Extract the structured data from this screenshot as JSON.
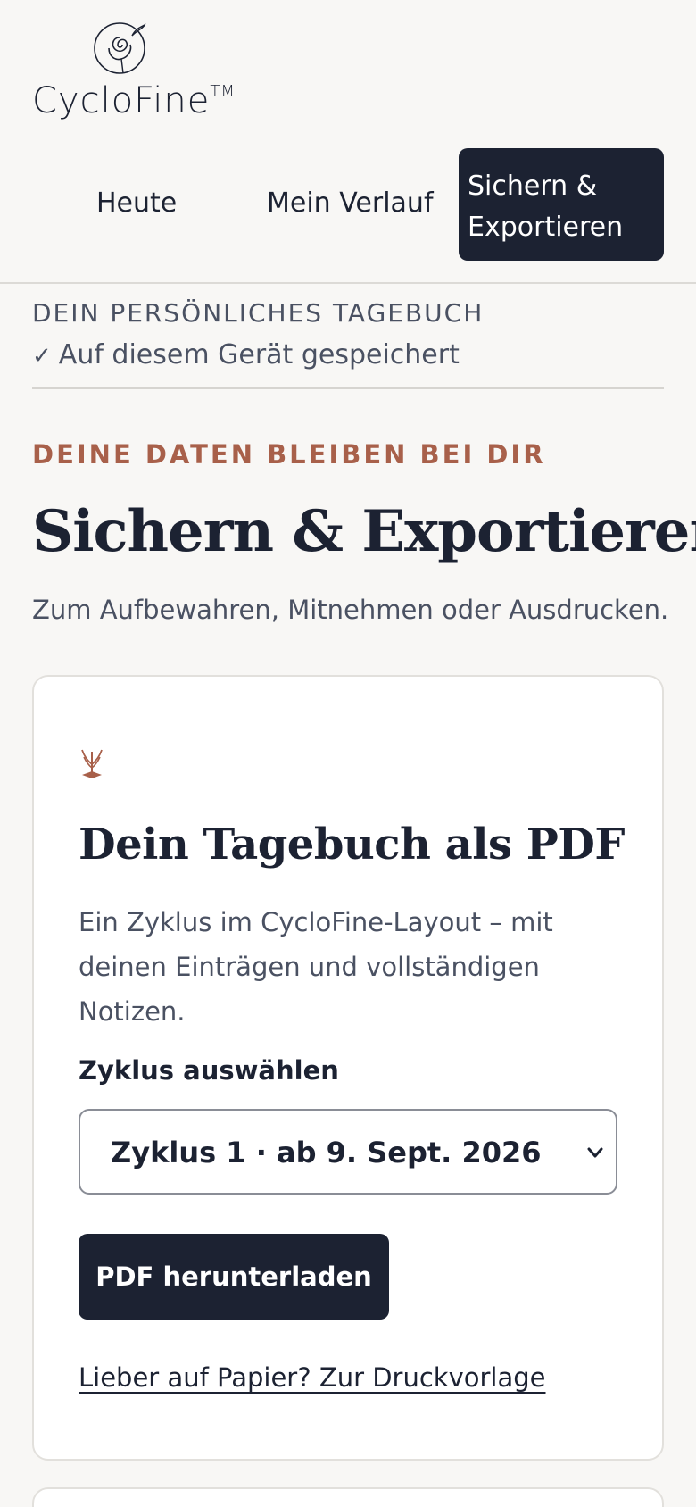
{
  "brand": {
    "name": "CycloFine",
    "trademark": "TM"
  },
  "nav": {
    "items": [
      {
        "label": "Heute"
      },
      {
        "label": "Mein Verlauf"
      },
      {
        "label": "Sichern & Exportieren",
        "active": true
      }
    ]
  },
  "diary": {
    "title": "DEIN PERSÖNLICHES TAGEBUCH",
    "status": "Auf diesem Gerät gespeichert"
  },
  "header": {
    "eyebrow": "DEINE DATEN BLEIBEN BEI DIR",
    "title": "Sichern & Exportieren",
    "subtitle": "Zum Aufbewahren, Mitnehmen oder Ausdrucken."
  },
  "pdf_card": {
    "icon": "sprout-icon",
    "title": "Dein Tagebuch als PDF",
    "description": "Ein Zyklus im CycloFine-Layout – mit deinen Einträgen und vollständigen Notizen.",
    "select_label": "Zyklus auswählen",
    "select_value": "Zyklus 1 · ab 9. Sept. 2026",
    "button_label": "PDF herunterladen",
    "print_link": "Lieber auf Papier? Zur Druckvorlage"
  },
  "colors": {
    "background": "#f8f7f5",
    "primary": "#1c2232",
    "accent": "#a8604a",
    "muted_text": "#4a5162"
  }
}
